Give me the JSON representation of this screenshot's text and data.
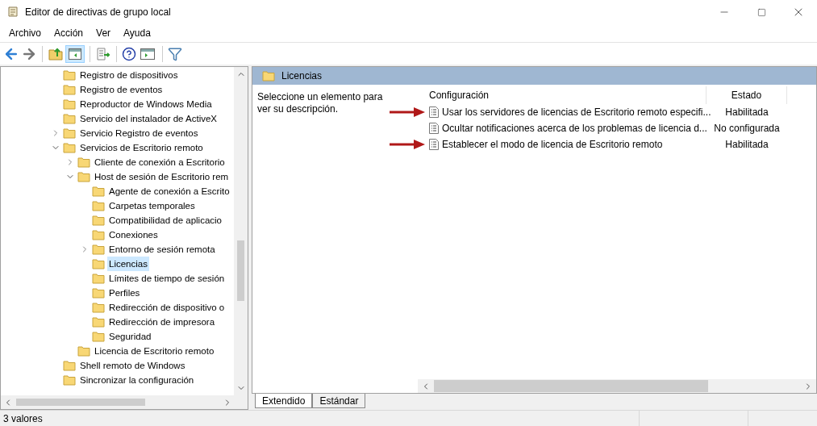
{
  "window": {
    "title": "Editor de directivas de grupo local"
  },
  "menu": [
    "Archivo",
    "Acción",
    "Ver",
    "Ayuda"
  ],
  "toolbar": {
    "show_tree_pressed": true
  },
  "tree": [
    {
      "label": "Registro de dispositivos",
      "selected": false
    },
    {
      "label": "Registro de eventos",
      "selected": false
    },
    {
      "label": "Reproductor de Windows Media",
      "selected": false
    },
    {
      "label": "Servicio del instalador de ActiveX",
      "selected": false
    },
    {
      "label": "Servicio Registro de eventos",
      "selected": false,
      "expanded": false
    },
    {
      "label": "Servicios de Escritorio remoto",
      "selected": false,
      "expanded": true,
      "children": [
        {
          "label": "Cliente de conexión a Escritorio",
          "selected": false,
          "expanded": false
        },
        {
          "label": "Host de sesión de Escritorio rem",
          "selected": false,
          "expanded": true,
          "children": [
            {
              "label": "Agente de conexión a Escrito",
              "selected": false
            },
            {
              "label": "Carpetas temporales",
              "selected": false
            },
            {
              "label": "Compatibilidad de aplicacio",
              "selected": false
            },
            {
              "label": "Conexiones",
              "selected": false
            },
            {
              "label": "Entorno de sesión remota",
              "selected": false,
              "expanded": false
            },
            {
              "label": "Licencias",
              "selected": true
            },
            {
              "label": "Límites de tiempo de sesión",
              "selected": false
            },
            {
              "label": "Perfiles",
              "selected": false
            },
            {
              "label": "Redirección de dispositivo o",
              "selected": false
            },
            {
              "label": "Redirección de impresora",
              "selected": false
            },
            {
              "label": "Seguridad",
              "selected": false
            }
          ]
        },
        {
          "label": "Licencia de Escritorio remoto",
          "selected": false
        }
      ]
    },
    {
      "label": "Shell remoto de Windows",
      "selected": false
    },
    {
      "label": "Sincronizar la configuración",
      "selected": false
    }
  ],
  "details": {
    "title": "Licencias",
    "description": "Seleccione un elemento para ver su descripción.",
    "columns": [
      "Configuración",
      "Estado"
    ],
    "rows": [
      {
        "setting": "Usar los servidores de licencias de Escritorio remoto especifi...",
        "state": "Habilitada",
        "marked": true
      },
      {
        "setting": "Ocultar notificaciones acerca de los problemas de licencia d...",
        "state": "No configurada",
        "marked": false
      },
      {
        "setting": "Establecer el modo de licencia de Escritorio remoto",
        "state": "Habilitada",
        "marked": true
      }
    ]
  },
  "view_tabs": [
    {
      "label": "Extendido",
      "selected": true
    },
    {
      "label": "Estándar",
      "selected": false
    }
  ],
  "status_bar": {
    "text": "3 valores"
  }
}
